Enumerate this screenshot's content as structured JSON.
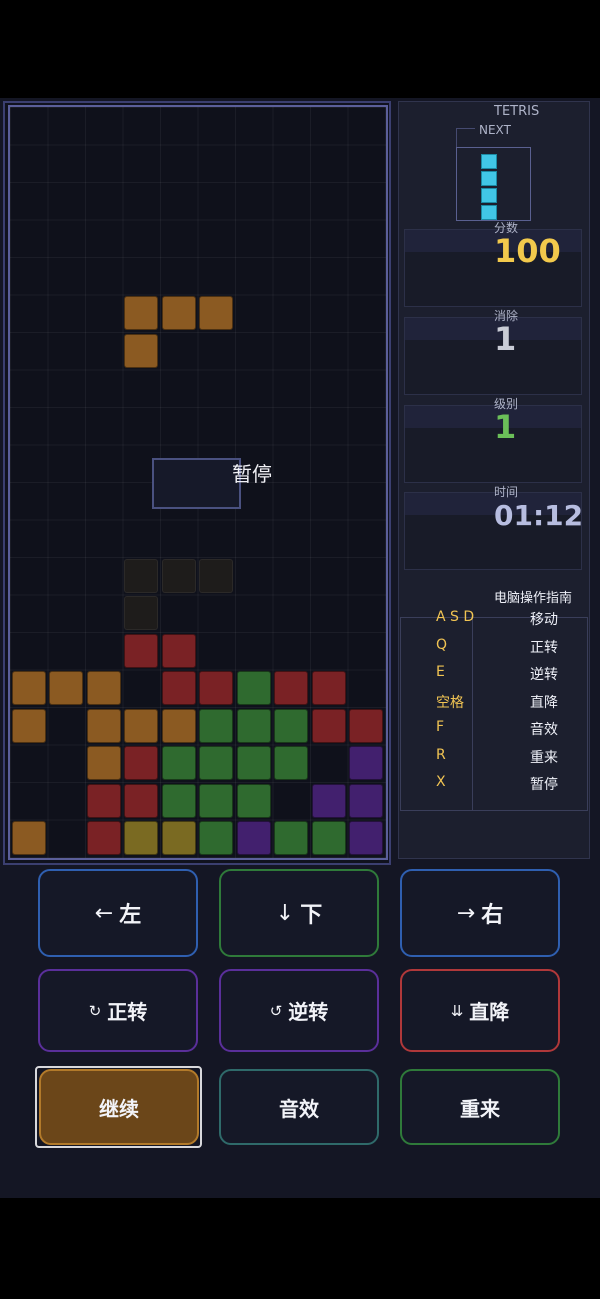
{
  "side": {
    "title": "TETRIS",
    "next_label": "NEXT",
    "score_label": "分数",
    "score": "100",
    "lines_label": "消除",
    "lines": "1",
    "level_label": "级别",
    "level": "1",
    "time_label": "时间",
    "time": "01:12",
    "guide_title": "电脑操作指南",
    "guide": [
      {
        "key": "A S D",
        "action": "移动"
      },
      {
        "key": "Q",
        "action": "正转"
      },
      {
        "key": "E",
        "action": "逆转"
      },
      {
        "key": "空格",
        "action": "直降"
      },
      {
        "key": "F",
        "action": "音效"
      },
      {
        "key": "R",
        "action": "重来"
      },
      {
        "key": "X",
        "action": "暂停"
      }
    ]
  },
  "overlay": {
    "paused": "暂停"
  },
  "buttons": {
    "left": {
      "icon": "←",
      "label": "左"
    },
    "down": {
      "icon": "↓",
      "label": "下"
    },
    "right": {
      "icon": "→",
      "label": "右"
    },
    "rotate_cw": {
      "icon": "↻",
      "label": "正转"
    },
    "rotate_ccw": {
      "icon": "↺",
      "label": "逆转"
    },
    "hard_drop": {
      "icon": "⇊",
      "label": "直降"
    },
    "resume": "继续",
    "sound": "音效",
    "restart": "重来"
  },
  "colors": {
    "orange": "#8b5a22",
    "red": "#7a2225",
    "green": "#2f6a2f",
    "purple": "#42206e",
    "yellow": "#7a6a22",
    "cyan": "#41c6e6",
    "score": "#f2c94c",
    "lines": "#c9ccd6",
    "level": "#6bbf59",
    "time": "#b7bde0"
  },
  "board": {
    "columns": 10,
    "rows": 20,
    "active_piece": {
      "color": "orange",
      "cells": [
        [
          3,
          5
        ],
        [
          4,
          5
        ],
        [
          5,
          5
        ],
        [
          3,
          6
        ]
      ]
    },
    "ghost_piece": {
      "cells": [
        [
          3,
          12
        ],
        [
          4,
          12
        ],
        [
          5,
          12
        ],
        [
          3,
          13
        ]
      ]
    },
    "locked": [
      {
        "c": 3,
        "r": 14,
        "k": "red"
      },
      {
        "c": 4,
        "r": 14,
        "k": "red"
      },
      {
        "c": 0,
        "r": 15,
        "k": "orange"
      },
      {
        "c": 1,
        "r": 15,
        "k": "orange"
      },
      {
        "c": 2,
        "r": 15,
        "k": "orange"
      },
      {
        "c": 4,
        "r": 15,
        "k": "red"
      },
      {
        "c": 5,
        "r": 15,
        "k": "red"
      },
      {
        "c": 6,
        "r": 15,
        "k": "green"
      },
      {
        "c": 7,
        "r": 15,
        "k": "red"
      },
      {
        "c": 8,
        "r": 15,
        "k": "red"
      },
      {
        "c": 0,
        "r": 16,
        "k": "orange"
      },
      {
        "c": 2,
        "r": 16,
        "k": "orange"
      },
      {
        "c": 3,
        "r": 16,
        "k": "orange"
      },
      {
        "c": 4,
        "r": 16,
        "k": "orange"
      },
      {
        "c": 5,
        "r": 16,
        "k": "green"
      },
      {
        "c": 6,
        "r": 16,
        "k": "green"
      },
      {
        "c": 7,
        "r": 16,
        "k": "green"
      },
      {
        "c": 8,
        "r": 16,
        "k": "red"
      },
      {
        "c": 9,
        "r": 16,
        "k": "red"
      },
      {
        "c": 2,
        "r": 17,
        "k": "orange"
      },
      {
        "c": 3,
        "r": 17,
        "k": "red"
      },
      {
        "c": 4,
        "r": 17,
        "k": "green"
      },
      {
        "c": 5,
        "r": 17,
        "k": "green"
      },
      {
        "c": 6,
        "r": 17,
        "k": "green"
      },
      {
        "c": 7,
        "r": 17,
        "k": "green"
      },
      {
        "c": 9,
        "r": 17,
        "k": "purple"
      },
      {
        "c": 2,
        "r": 18,
        "k": "red"
      },
      {
        "c": 3,
        "r": 18,
        "k": "red"
      },
      {
        "c": 4,
        "r": 18,
        "k": "green"
      },
      {
        "c": 5,
        "r": 18,
        "k": "green"
      },
      {
        "c": 6,
        "r": 18,
        "k": "green"
      },
      {
        "c": 8,
        "r": 18,
        "k": "purple"
      },
      {
        "c": 9,
        "r": 18,
        "k": "purple"
      },
      {
        "c": 0,
        "r": 19,
        "k": "orange"
      },
      {
        "c": 2,
        "r": 19,
        "k": "red"
      },
      {
        "c": 3,
        "r": 19,
        "k": "yellow"
      },
      {
        "c": 4,
        "r": 19,
        "k": "yellow"
      },
      {
        "c": 5,
        "r": 19,
        "k": "green"
      },
      {
        "c": 6,
        "r": 19,
        "k": "purple"
      },
      {
        "c": 7,
        "r": 19,
        "k": "green"
      },
      {
        "c": 8,
        "r": 19,
        "k": "green"
      },
      {
        "c": 9,
        "r": 19,
        "k": "purple"
      }
    ]
  }
}
